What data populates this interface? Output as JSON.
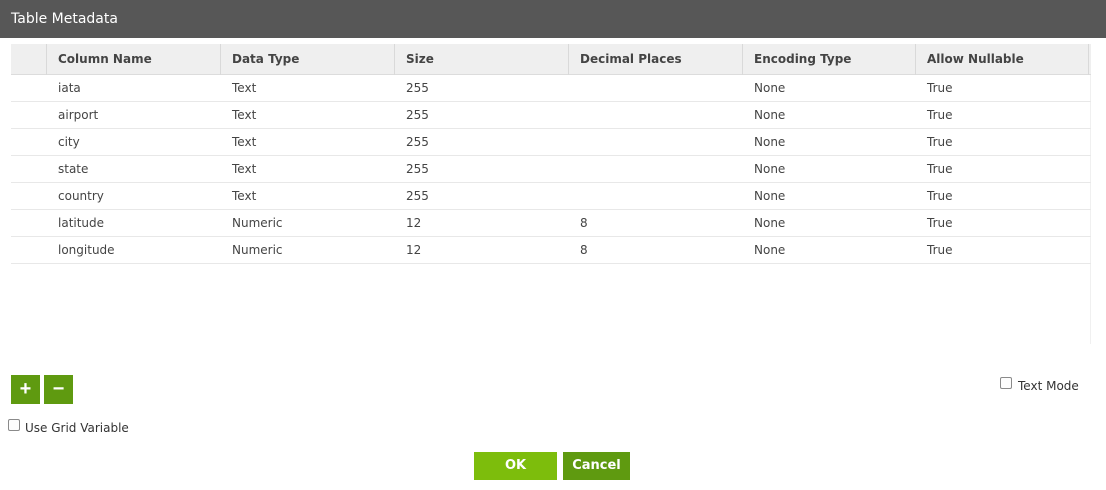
{
  "window": {
    "title": "Table Metadata"
  },
  "table": {
    "columns": [
      "",
      "Column Name",
      "Data Type",
      "Size",
      "Decimal Places",
      "Encoding Type",
      "Allow Nullable"
    ],
    "rows": [
      [
        "",
        "iata",
        "Text",
        "255",
        "",
        "None",
        "True"
      ],
      [
        "",
        "airport",
        "Text",
        "255",
        "",
        "None",
        "True"
      ],
      [
        "",
        "city",
        "Text",
        "255",
        "",
        "None",
        "True"
      ],
      [
        "",
        "state",
        "Text",
        "255",
        "",
        "None",
        "True"
      ],
      [
        "",
        "country",
        "Text",
        "255",
        "",
        "None",
        "True"
      ],
      [
        "",
        "latitude",
        "Numeric",
        "12",
        "8",
        "None",
        "True"
      ],
      [
        "",
        "longitude",
        "Numeric",
        "12",
        "8",
        "None",
        "True"
      ]
    ]
  },
  "controls": {
    "add_label": "+",
    "remove_label": "−",
    "text_mode_label": "Text Mode",
    "use_grid_variable_label": "Use Grid Variable",
    "text_mode_checked": false,
    "use_grid_variable_checked": false
  },
  "footer": {
    "ok_label": "OK",
    "cancel_label": "Cancel"
  },
  "colors": {
    "titlebar": "#575757",
    "ok_button": "#7dbd0c",
    "action_button": "#5f9a10",
    "header_bg": "#efefef"
  }
}
